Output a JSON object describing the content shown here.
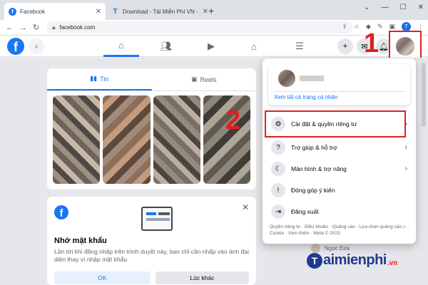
{
  "browser": {
    "tabs": [
      {
        "title": "Facebook",
        "active": true
      },
      {
        "title": "Download - Tải Miễn Phí VN - Ph",
        "active": false
      }
    ],
    "url": "facebook.com",
    "profile_initial": "T"
  },
  "feed": {
    "tabs": [
      {
        "label": "Tin",
        "active": true
      },
      {
        "label": "Reels",
        "active": false
      }
    ]
  },
  "password_prompt": {
    "title": "Nhớ mật khẩu",
    "text": "Lần tới khi đăng nhập trên trình duyệt này, bạn chỉ cần nhấp vào ảnh đại diện thay vì nhập mật khẩu",
    "ok_label": "OK",
    "later_label": "Lúc khác"
  },
  "menu": {
    "profile_link": "Xem tất cả trang cá nhân",
    "items": [
      {
        "label": "Cài đặt & quyền riêng tư",
        "icon": "gear-icon",
        "has_chevron": true
      },
      {
        "label": "Trợ giúp & hỗ trợ",
        "icon": "help-icon",
        "has_chevron": true
      },
      {
        "label": "Màn hình & trợ năng",
        "icon": "moon-icon",
        "has_chevron": true
      },
      {
        "label": "Đóng góp ý kiến",
        "icon": "feedback-icon",
        "has_chevron": false
      },
      {
        "label": "Đăng xuất",
        "icon": "logout-icon",
        "has_chevron": false
      }
    ],
    "footer": "Quyền riêng tư · Điều khoản · Quảng cáo · Lựa chọn quảng cáo ▷ · Cookie · Xem thêm · Meta © 2023"
  },
  "contact_name": "Ngọc Eira",
  "annotations": {
    "step1": "1",
    "step2": "2"
  },
  "watermark": {
    "brand": "aimienphi",
    "tld": ".vn",
    "logo_letter": "T"
  },
  "colors": {
    "facebook_blue": "#1877f2",
    "highlight_red": "#e02020"
  }
}
